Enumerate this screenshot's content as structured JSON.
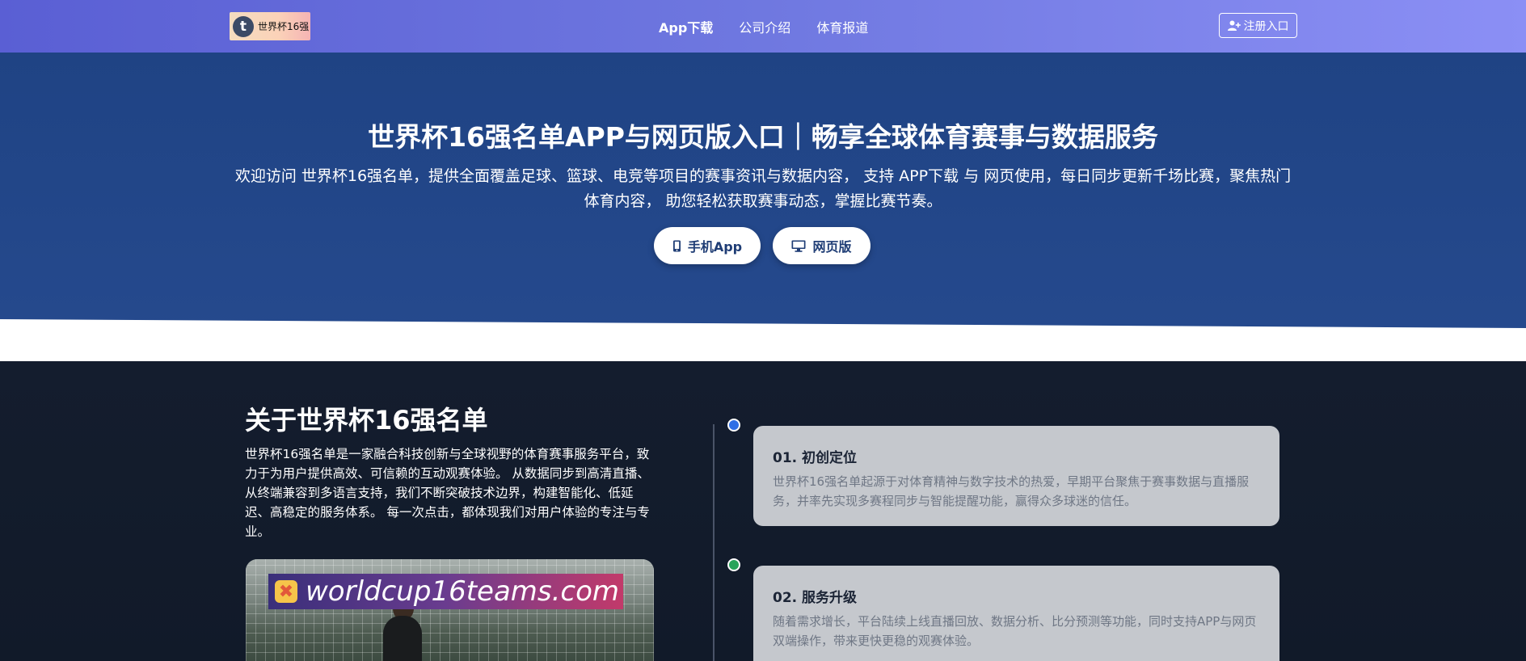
{
  "nav": {
    "logo_text": "世界杯16强",
    "logo_letter": "t",
    "links": [
      "App下载",
      "公司介绍",
      "体育报道"
    ],
    "register_label": "注册入口"
  },
  "hero": {
    "title": "世界杯16强名单APP与网页版入口｜畅享全球体育赛事与数据服务",
    "description": "欢迎访问 世界杯16强名单，提供全面覆盖足球、篮球、电竞等项目的赛事资讯与数据内容， 支持 APP下载 与 网页使用，每日同步更新千场比赛，聚焦热门体育内容， 助您轻松获取赛事动态，掌握比赛节奏。",
    "buttons": [
      {
        "label": "手机App",
        "icon": "mobile-icon"
      },
      {
        "label": "网页版",
        "icon": "desktop-icon"
      }
    ]
  },
  "about": {
    "title": "关于世界杯16强名单",
    "description": "世界杯16强名单是一家融合科技创新与全球视野的体育赛事服务平台，致力于为用户提供高效、可信赖的互动观赛体验。 从数据同步到高清直播、从终端兼容到多语言支持，我们不断突破技术边界，构建智能化、低延迟、高稳定的服务体系。 每一次点击，都体现我们对用户体验的专注与专业。",
    "image_watermark": "worldcup16teams.com"
  },
  "timeline": [
    {
      "title": "01. 初创定位",
      "text": "世界杯16强名单起源于对体育精神与数字技术的热爱，早期平台聚焦于赛事数据与直播服务，并率先实现多赛程同步与智能提醒功能，赢得众多球迷的信任。",
      "dot_color": "#2f6fe6"
    },
    {
      "title": "02. 服务升级",
      "text": "随着需求增长，平台陆续上线直播回放、数据分析、比分预测等功能，同时支持APP与网页双端操作，带来更快更稳的观赛体验。",
      "dot_color": "#27a35a"
    }
  ]
}
